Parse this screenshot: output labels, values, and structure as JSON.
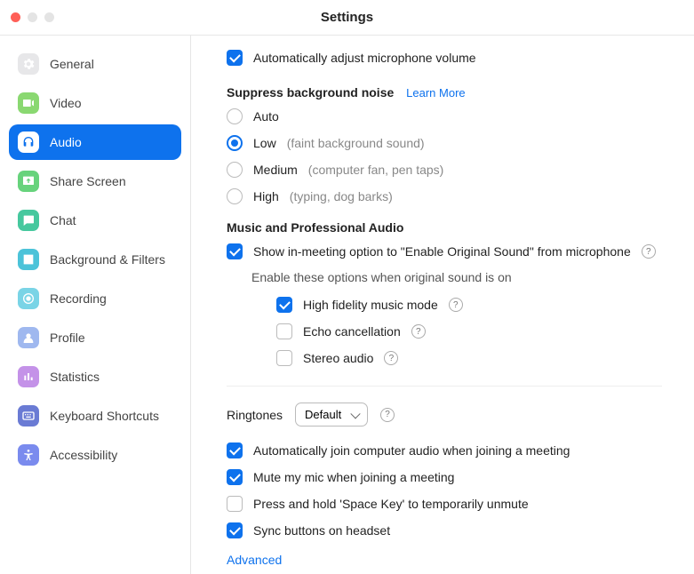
{
  "title": "Settings",
  "sidebar": {
    "items": [
      {
        "label": "General"
      },
      {
        "label": "Video"
      },
      {
        "label": "Audio"
      },
      {
        "label": "Share Screen"
      },
      {
        "label": "Chat"
      },
      {
        "label": "Background & Filters"
      },
      {
        "label": "Recording"
      },
      {
        "label": "Profile"
      },
      {
        "label": "Statistics"
      },
      {
        "label": "Keyboard Shortcuts"
      },
      {
        "label": "Accessibility"
      }
    ]
  },
  "audio": {
    "auto_adjust": "Automatically adjust microphone volume",
    "suppress_title": "Suppress background noise",
    "learn_more": "Learn More",
    "suppress_options": {
      "auto": {
        "label": "Auto",
        "hint": ""
      },
      "low": {
        "label": "Low",
        "hint": "(faint background sound)"
      },
      "medium": {
        "label": "Medium",
        "hint": "(computer fan, pen taps)"
      },
      "high": {
        "label": "High",
        "hint": "(typing, dog barks)"
      }
    },
    "music_title": "Music and Professional Audio",
    "original_sound": "Show in-meeting option to \"Enable Original Sound\" from microphone",
    "enable_sub": "Enable these options when original sound is on",
    "high_fidelity": "High fidelity music mode",
    "echo": "Echo cancellation",
    "stereo": "Stereo audio",
    "ringtones_label": "Ringtones",
    "ringtones_value": "Default",
    "auto_join": "Automatically join computer audio when joining a meeting",
    "mute_join": "Mute my mic when joining a meeting",
    "space_unmute": "Press and hold 'Space Key' to temporarily unmute",
    "sync_headset": "Sync buttons on headset",
    "advanced": "Advanced"
  }
}
